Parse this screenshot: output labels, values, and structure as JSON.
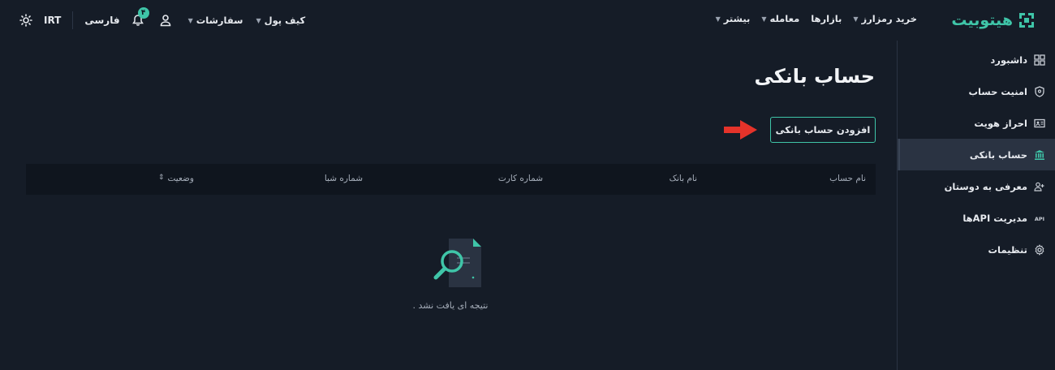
{
  "brand": {
    "name": "هیتوبیت",
    "accent": "#3fc5a8"
  },
  "nav": [
    {
      "label": "خرید رمزارز",
      "caret": true
    },
    {
      "label": "بازارها",
      "caret": false
    },
    {
      "label": "معامله",
      "caret": true
    },
    {
      "label": "بیشتر",
      "caret": true
    }
  ],
  "nav_left": [
    {
      "label": "کیف پول",
      "caret": true
    },
    {
      "label": "سفارشات",
      "caret": true
    }
  ],
  "tools": {
    "currency": "IRT",
    "language": "فارسی",
    "notification_count": "۴"
  },
  "sidebar": {
    "items": [
      {
        "label": "داشبورد",
        "icon": "dashboard-icon"
      },
      {
        "label": "امنیت حساب",
        "icon": "shield-icon"
      },
      {
        "label": "احراز هویت",
        "icon": "id-card-icon"
      },
      {
        "label": "حساب بانکی",
        "icon": "bank-icon",
        "active": true
      },
      {
        "label": "معرفی به دوستان",
        "icon": "users-icon"
      },
      {
        "label": "مدیریت APIها",
        "icon": "api-icon"
      },
      {
        "label": "تنظیمات",
        "icon": "gear-icon"
      }
    ]
  },
  "main": {
    "title": "حساب بانکی",
    "add_button": "افزودن حساب بانکی",
    "columns": [
      "نام حساب",
      "نام بانک",
      "شماره کارت",
      "شماره شبا",
      "وضعیت"
    ],
    "sort_glyph": "⇕",
    "empty_text": "نتیجه ای یافت نشد ."
  }
}
